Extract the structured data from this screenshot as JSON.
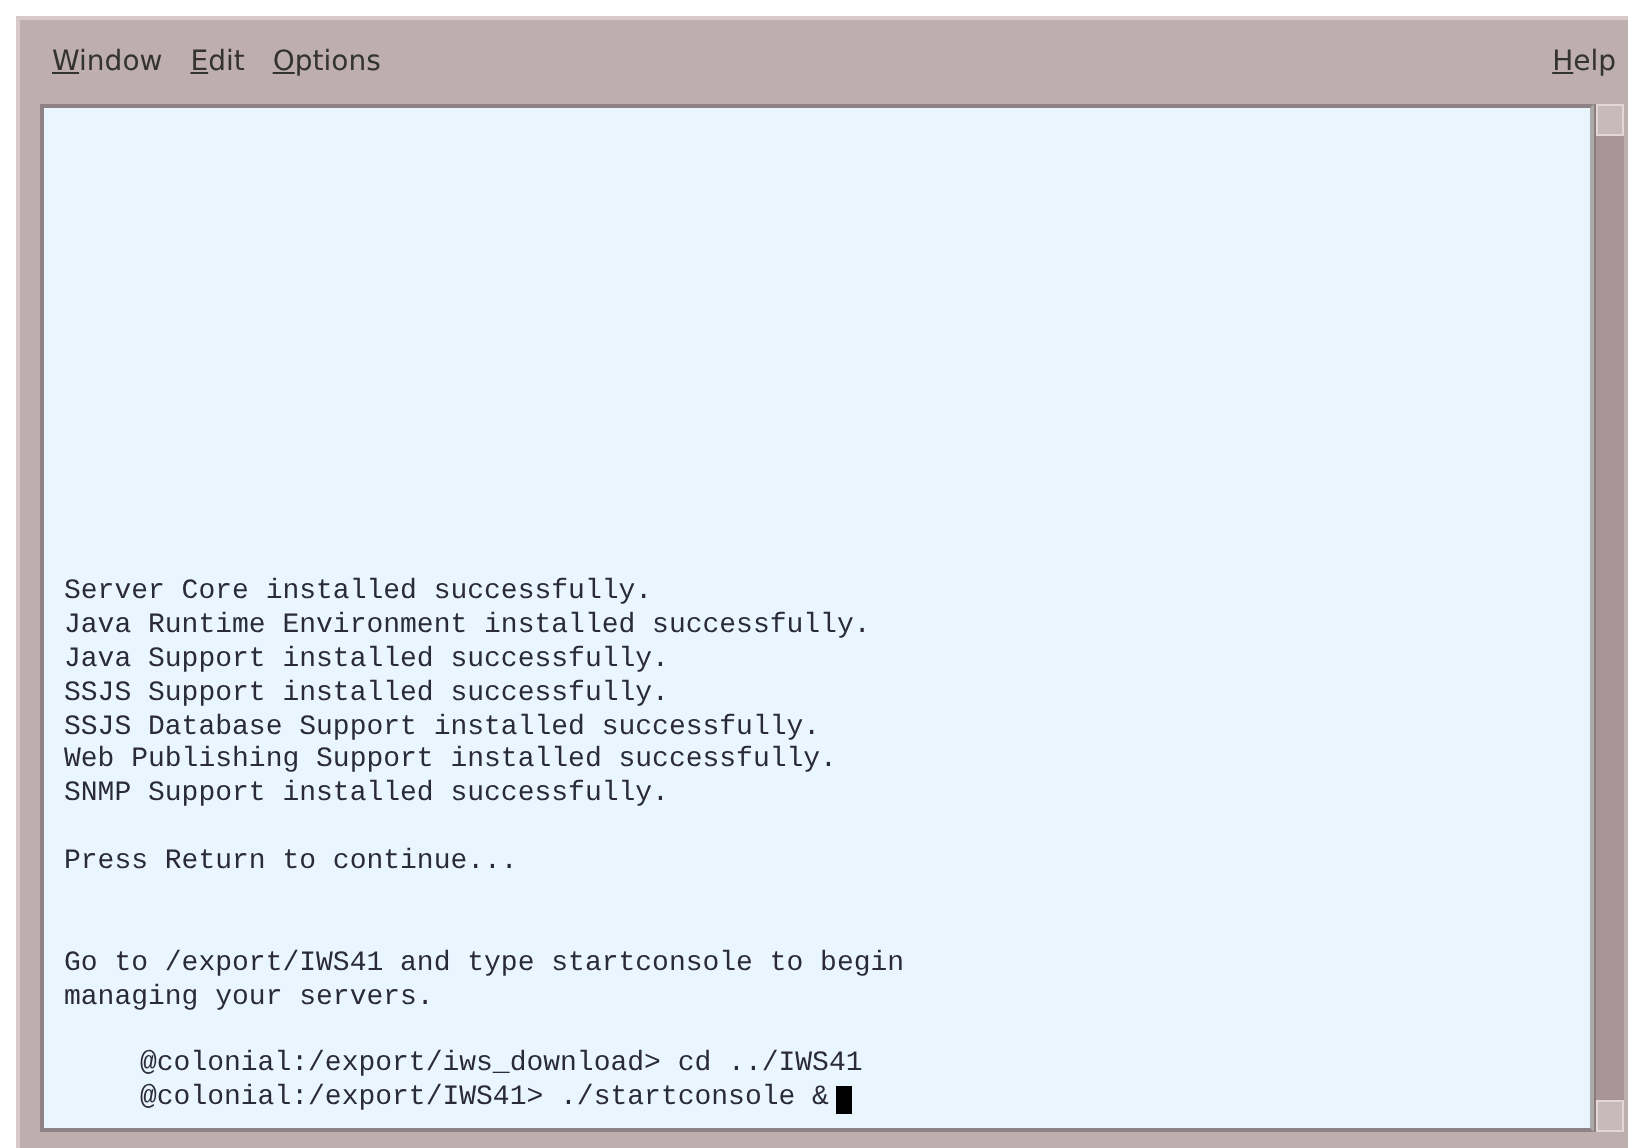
{
  "menu_bar": {
    "left": [
      {
        "label": "Window"
      },
      {
        "label": "Edit"
      },
      {
        "label": "Options"
      }
    ],
    "right": [
      {
        "label": "Help"
      }
    ]
  },
  "terminal": {
    "blocks": [
      {
        "lines": [
          {
            "text": "Server Core installed successfully.",
            "kind": "output",
            "cursor": false
          },
          {
            "text": "Java Runtime Environment installed successfully.",
            "kind": "output",
            "cursor": false
          },
          {
            "text": "Java Support installed successfully.",
            "kind": "output",
            "cursor": false
          },
          {
            "text": "SSJS Support installed successfully.",
            "kind": "output",
            "cursor": false
          },
          {
            "text": "SSJS Database Support installed successfully.",
            "kind": "output",
            "cursor": false
          },
          {
            "text": "Web Publishing Support installed successfully.",
            "kind": "output",
            "cursor": false
          },
          {
            "text": "SNMP Support installed successfully.",
            "kind": "output",
            "cursor": false
          }
        ]
      },
      {
        "lines": [
          {
            "text": "Press Return to continue...",
            "kind": "output",
            "cursor": false
          }
        ]
      },
      {
        "lines": [
          {
            "text": "Go to /export/IWS41 and type startconsole to begin",
            "kind": "output",
            "cursor": false
          },
          {
            "text": "managing your servers.",
            "kind": "output",
            "cursor": false
          }
        ]
      },
      {
        "lines": [
          {
            "text": "@colonial:/export/iws_download> cd ../IWS41",
            "kind": "prompt",
            "cursor": false
          },
          {
            "text": "@colonial:/export/IWS41> ./startconsole &",
            "kind": "prompt",
            "cursor": true
          }
        ]
      }
    ]
  }
}
